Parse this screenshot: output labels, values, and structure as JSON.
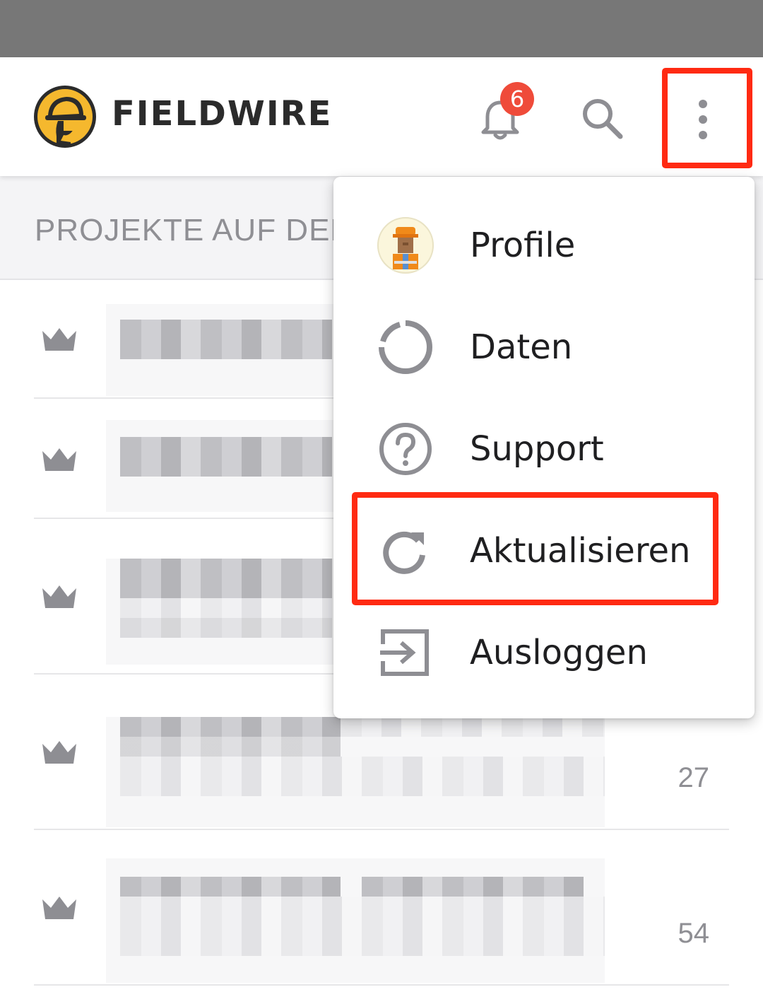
{
  "app": {
    "brand": "FIELDWIRE"
  },
  "header": {
    "notifications_count": "6",
    "accent_color": "#ef4b3a"
  },
  "subheader": {
    "title": "PROJEKTE AUF DEM"
  },
  "projects": [
    {
      "count": ""
    },
    {
      "count": ""
    },
    {
      "count": ""
    },
    {
      "count": "27"
    },
    {
      "count": "54"
    }
  ],
  "menu": {
    "items": [
      {
        "label": "Profile",
        "icon": "avatar-icon"
      },
      {
        "label": "Daten",
        "icon": "data-ring-icon"
      },
      {
        "label": "Support",
        "icon": "help-icon"
      },
      {
        "label": "Aktualisieren",
        "icon": "refresh-icon"
      },
      {
        "label": "Ausloggen",
        "icon": "logout-icon"
      }
    ]
  },
  "highlight_color": "#ff2a12"
}
